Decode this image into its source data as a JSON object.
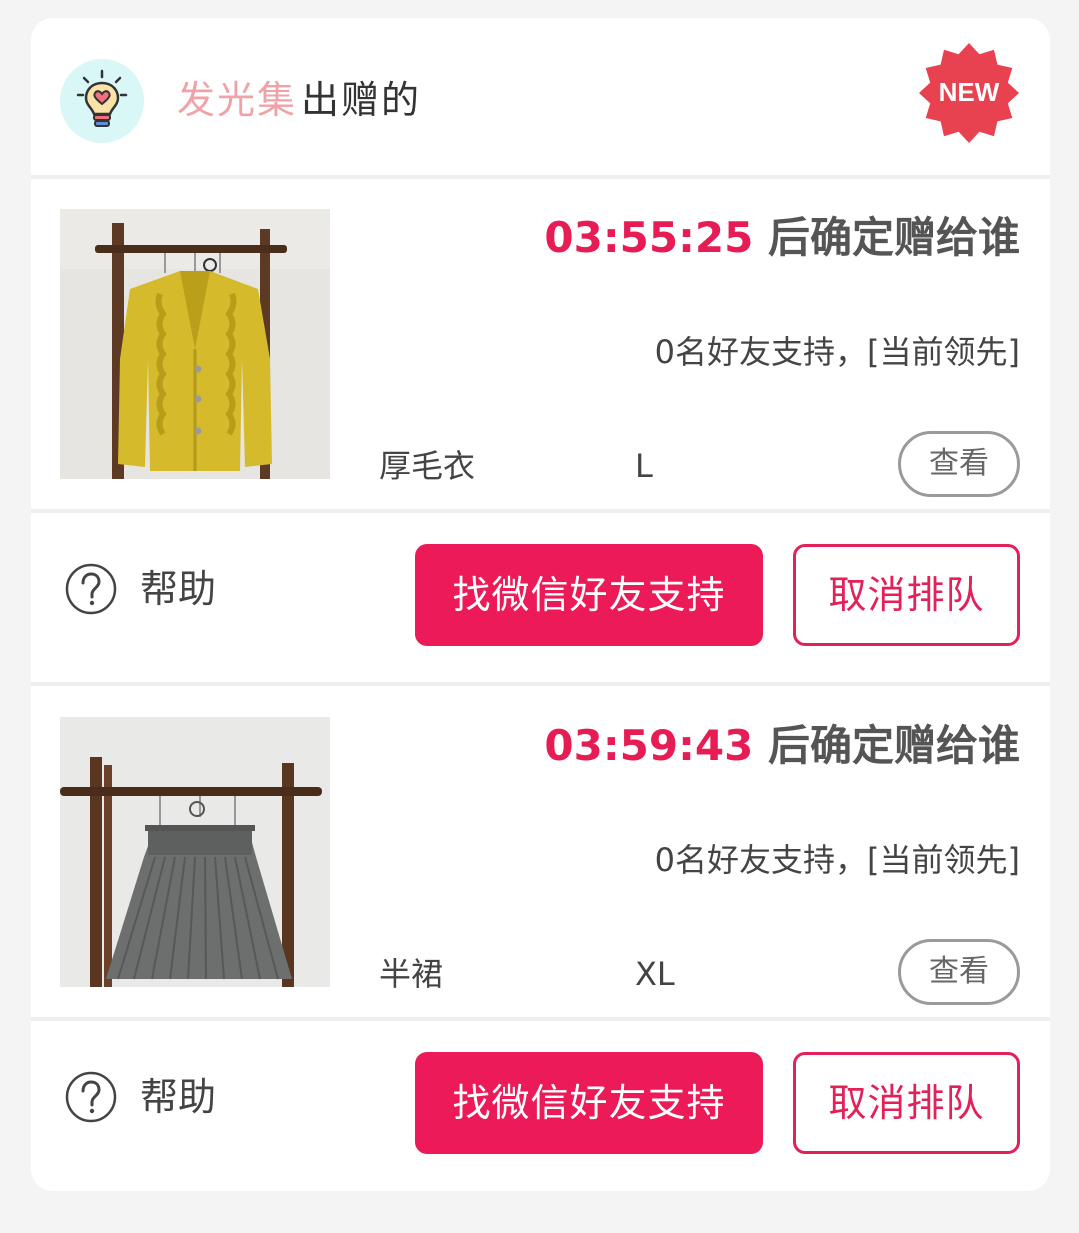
{
  "header": {
    "shop_name": "发光集",
    "action_text": "出赠的",
    "badge": "NEW"
  },
  "colors": {
    "accent": "#ec1b57",
    "shop_name": "#f0a2a9",
    "badge": "#e8414f"
  },
  "items": [
    {
      "countdown": "03:55:25",
      "countdown_suffix": "后确定赠给谁",
      "support_text": "0名好友支持，[当前领先]",
      "name": "厚毛衣",
      "size": "L",
      "view_label": "查看",
      "image": "yellow-cardigan-on-rack",
      "help_label": "帮助",
      "wechat_label": "找微信好友支持",
      "cancel_label": "取消排队"
    },
    {
      "countdown": "03:59:43",
      "countdown_suffix": "后确定赠给谁",
      "support_text": "0名好友支持，[当前领先]",
      "name": "半裙",
      "size": "XL",
      "view_label": "查看",
      "image": "grey-pleated-skirt-on-rack",
      "help_label": "帮助",
      "wechat_label": "找微信好友支持",
      "cancel_label": "取消排队"
    }
  ]
}
